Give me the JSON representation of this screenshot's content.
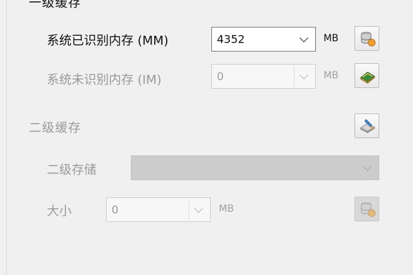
{
  "level1": {
    "header": "一级缓存",
    "recognized": {
      "label": "系统已识别内存 (MM)",
      "value": "4352",
      "unit": "MB"
    },
    "unrecognized": {
      "label": "系统未识别内存 (IM)",
      "value": "0",
      "unit": "MB"
    }
  },
  "level2": {
    "header": "二级缓存",
    "storage": {
      "label": "二级存储",
      "value": ""
    },
    "size": {
      "label": "大小",
      "value": "0",
      "unit": "MB"
    }
  },
  "icons": {
    "recognized_button": "database-icon",
    "unrecognized_button": "memory-chip-icon",
    "level2_button": "disk-wizard-icon",
    "size_button": "database-icon"
  },
  "colors": {
    "enabled_text": "#111111",
    "disabled_text": "#9a9a9a",
    "accent_orange": "#f0a030"
  }
}
